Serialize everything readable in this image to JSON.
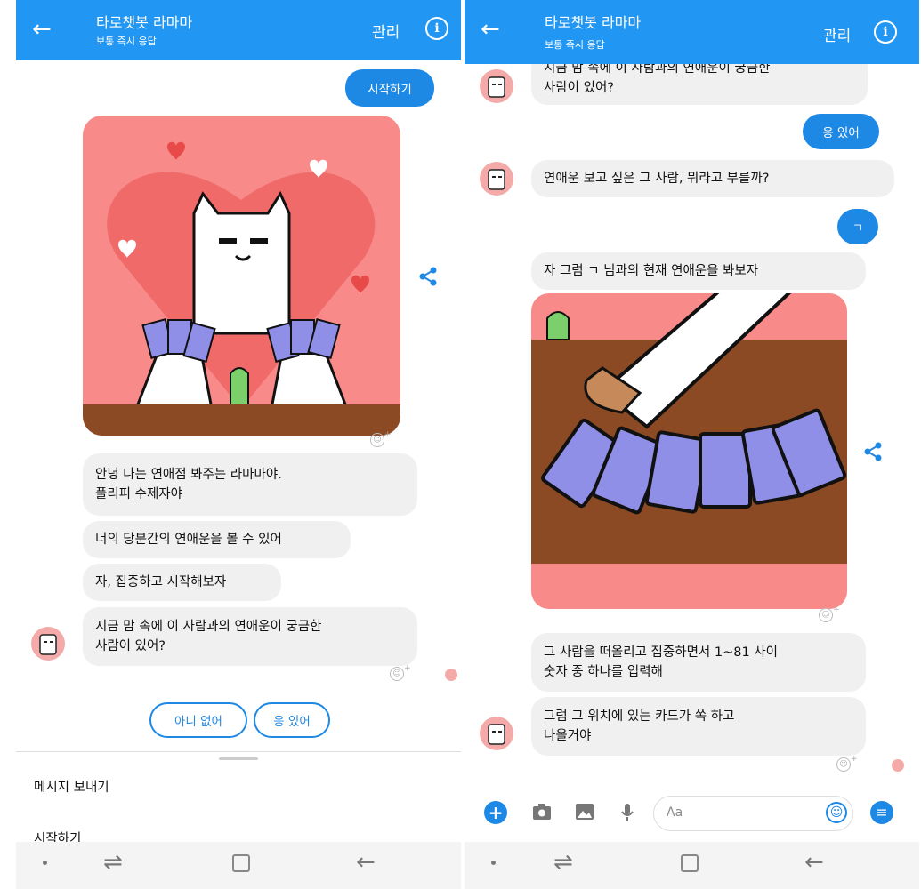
{
  "header": {
    "title": "타로챗봇 라마마",
    "subtitle": "보통 즉시 응답",
    "manage_label": "관리",
    "info_glyph": "i",
    "back_glyph": "←"
  },
  "left": {
    "start_button": "시작하기",
    "messages": [
      "안녕 나는 연애점 봐주는 라마마야.",
      "풀리피 수제자야",
      "너의 당분간의 연애운을 볼 수 있어",
      "자, 집중하고 시작해보자",
      "지금 맘 속에 이 사람과의 연애운이 궁금한",
      "사람이 있어?"
    ],
    "quick_replies": [
      "아니 없어",
      "응 있어"
    ],
    "menu": [
      "메시지 보내기",
      "시작하기"
    ]
  },
  "right": {
    "partial_line": "지금 맘 속에 이 사람과의 연애운이 궁금한",
    "message_1": "사람이 있어?",
    "reply_1": "응 있어",
    "message_2": "연애운 보고 싶은 그 사람, 뭐라고 부를까?",
    "reply_2": "ㄱ",
    "message_3": "자 그럼 ㄱ 님과의 현재 연애운을 봐보자",
    "message_4a": "그 사람을 떠올리고 집중하면서 1~81 사이",
    "message_4b": "숫자 중 하나를 입력해",
    "message_5a": "그럼 그 위치에 있는 카드가 쏙 하고",
    "message_5b": "나올거야",
    "composer_placeholder": "Aa"
  },
  "icons": {
    "share": "share-icon",
    "react": "smiley-icon",
    "plus": "plus-icon",
    "camera": "camera-icon",
    "gallery": "gallery-icon",
    "mic": "mic-icon",
    "emoji": "emoji-icon",
    "menu": "menu-icon"
  },
  "colors": {
    "messenger_blue": "#2196f3",
    "bubble_grey": "#f1f0f0",
    "card_pink": "#f98a8a",
    "table_brown": "#8b4a23",
    "card_purple": "#8f8fe8"
  }
}
